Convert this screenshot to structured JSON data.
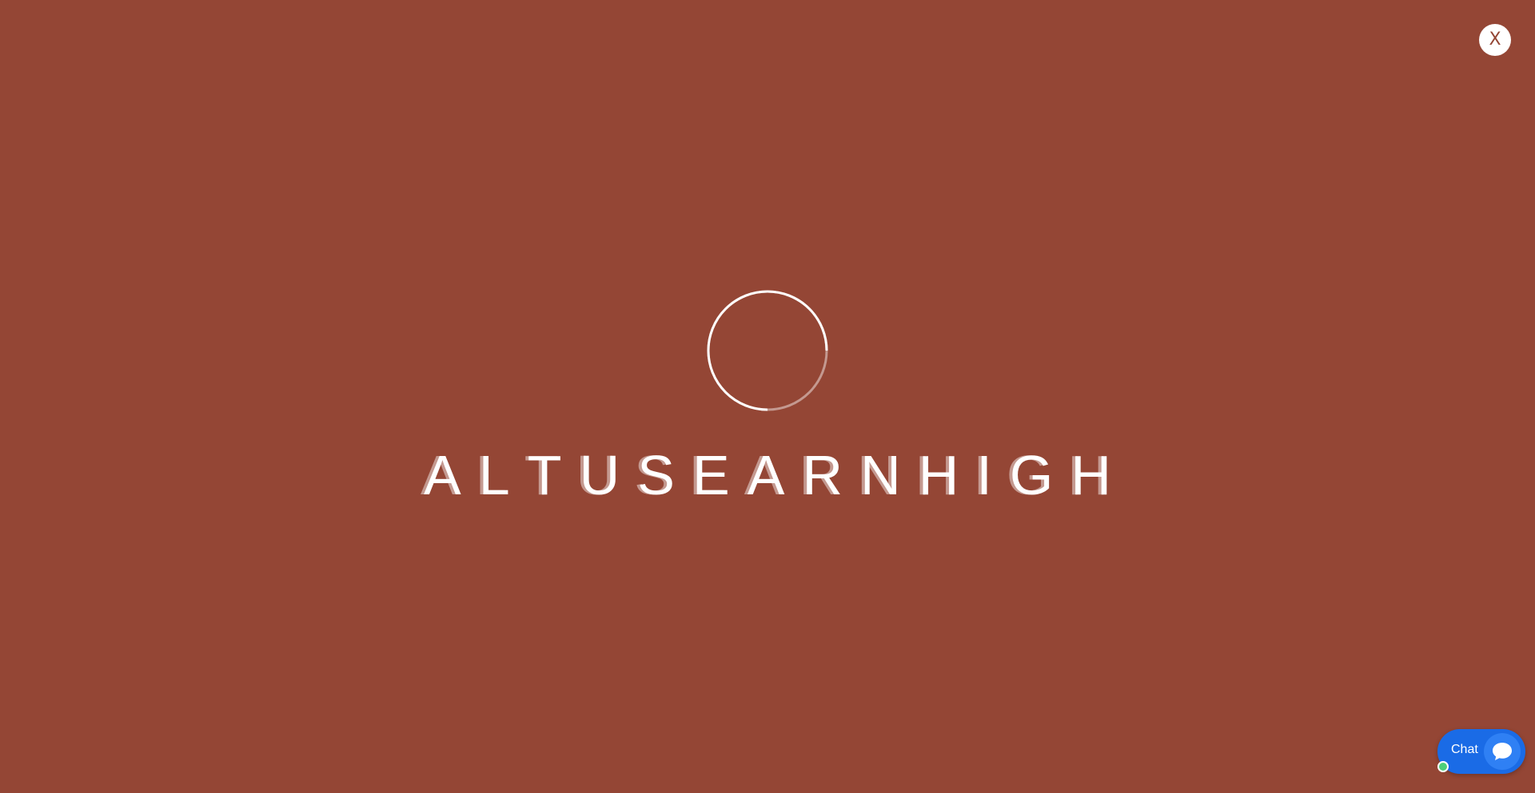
{
  "overlay": {
    "background_color": "#944635",
    "close_label": "X"
  },
  "loader": {
    "icon": "loading-spinner-icon"
  },
  "brand": {
    "letters": [
      "A",
      "L",
      "T",
      "U",
      "S",
      "E",
      "A",
      "R",
      "N",
      "H",
      "I",
      "G",
      "H"
    ]
  },
  "chat": {
    "label": "Chat",
    "icon": "chat-bubble-icon",
    "status": "online",
    "status_color": "#4cd07a",
    "accent_color": "#1a6be6"
  }
}
